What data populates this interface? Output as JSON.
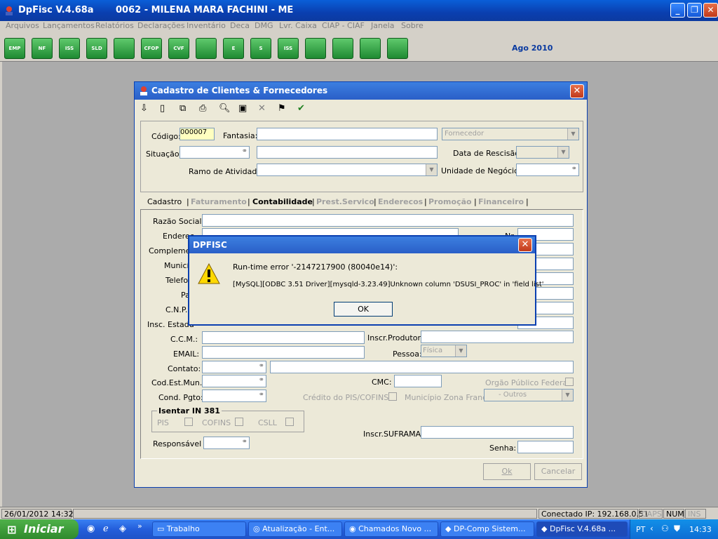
{
  "app": {
    "name": "DpFisc V.4.68a",
    "company": "0062 - MILENA MARA FACHINI - ME",
    "period": "Ago  2010"
  },
  "menu": [
    "Arquivos",
    "Lançamentos",
    "Relatórios",
    "Declarações",
    "Inventário",
    "Deca",
    "DMG",
    "Lvr. Caixa",
    "CIAP - CIAF",
    "Janela",
    "Sobre"
  ],
  "toolbar": {
    "buttons": [
      "EMP",
      "NF",
      "ISS",
      "SLD",
      "",
      "CFOP",
      "CVF",
      "",
      "E",
      "S",
      "ISS",
      "",
      "",
      "",
      ""
    ]
  },
  "dialog": {
    "title": "Cadastro de Clientes & Fornecedores",
    "codigo_label": "Código:",
    "codigo_value": "000007",
    "fantasia_label": "Fantasia:",
    "tipo_value": "Fornecedor",
    "situacao_label": "Situação:",
    "data_rescisao_label": "Data de Rescisão:",
    "ramo_label": "Ramo de Atividade:",
    "unidade_label": "Unidade de Negócios:",
    "tabs": [
      "Cadastro",
      "Faturamento",
      "Contabilidade",
      "Prest.Servico",
      "Enderecos",
      "Promoção",
      "Financeiro"
    ],
    "fields": {
      "razao": "Razão Social:",
      "endereco": "Endereç",
      "complemento": "Complemen",
      "municipio": "Municíp",
      "telefone": "Telefon",
      "pais": "Pa",
      "cnpj": "C.N.P.",
      "insc_estadual": "Insc. Estadu",
      "nr": "Nr",
      "ccm": "C.C.M.:",
      "inscr_produtor": "Inscr.Produtor:",
      "email": "EMAIL:",
      "pessoa": "Pessoa:",
      "pessoa_value": "Física",
      "contato": "Contato:",
      "cod_est_mun": "Cod.Est.Mun.:",
      "cmc": "CMC:",
      "orgao": "Orgão Público Federal",
      "cond_pgto": "Cond. Pgto:",
      "credito": "Crédito do PIS/COFINS",
      "zona_franca": "Município Zona Franca",
      "outros_value": "- Outros",
      "isentar": "Isentar IN 381",
      "pis": "PIS",
      "cofins": "COFINS",
      "csll": "CSLL",
      "suframa": "Inscr.SUFRAMA:",
      "responsavel": "Responsável :",
      "senha": "Senha:"
    },
    "ok_label": "Ok",
    "cancel_label": "Cancelar"
  },
  "error": {
    "title": "DPFISC",
    "line1": "Run-time error '-2147217900 (80040e14)':",
    "line2": "[MySQL][ODBC 3.51 Driver][mysqld-3.23.49]Unknown column 'DSUSI_PROC' in 'field list'",
    "ok": "OK"
  },
  "status": {
    "datetime": "26/01/2012 14:32",
    "connection": "Conectado IP: 192.168.0.51",
    "caps": "CAPS",
    "num": "NUM",
    "ins": "INS"
  },
  "taskbar": {
    "start": "Iniciar",
    "items": [
      "Trabalho",
      "Atualização - Ent...",
      "Chamados Novo ...",
      "DP-Comp Sistem...",
      "DpFisc V.4.68a ..."
    ],
    "lang": "PT",
    "clock": "14:33"
  }
}
